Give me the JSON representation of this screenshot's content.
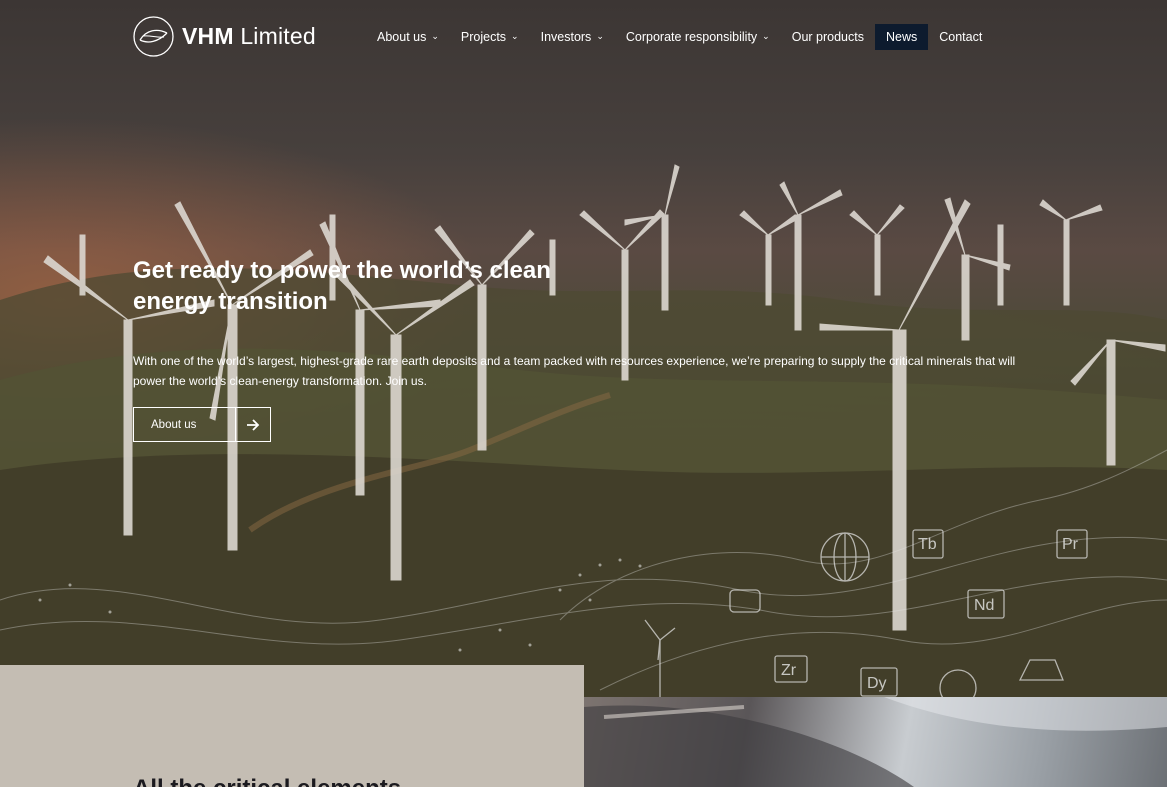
{
  "brand": {
    "name_bold": "VHM",
    "name_light": "Limited"
  },
  "nav": {
    "items": [
      {
        "label": "About us",
        "has_dropdown": true
      },
      {
        "label": "Projects",
        "has_dropdown": true
      },
      {
        "label": "Investors",
        "has_dropdown": true
      },
      {
        "label": "Corporate responsibility",
        "has_dropdown": true
      },
      {
        "label": "Our products",
        "has_dropdown": false
      },
      {
        "label": "News",
        "has_dropdown": false,
        "active": true
      },
      {
        "label": "Contact",
        "has_dropdown": false
      }
    ],
    "chevron_glyph": "⌄"
  },
  "hero": {
    "title": "Get ready to power the world’s clean energy transition",
    "body": "With one of the world’s largest, highest-grade rare earth deposits and a team packed with resources experience, we’re preparing to supply the critical minerals that will power the world’s clean-energy transformation. Join us.",
    "cta_label": "About us",
    "cta_icon": "arrow-right-icon",
    "element_badges": [
      "Tb",
      "Pr",
      "Nd",
      "Zr",
      "Dy"
    ]
  },
  "section2": {
    "title": "All the critical elements"
  },
  "colors": {
    "nav_active_bg": "#0d1b2e",
    "lower_panel_bg": "#c4bdb3",
    "text_light": "#ffffff"
  }
}
